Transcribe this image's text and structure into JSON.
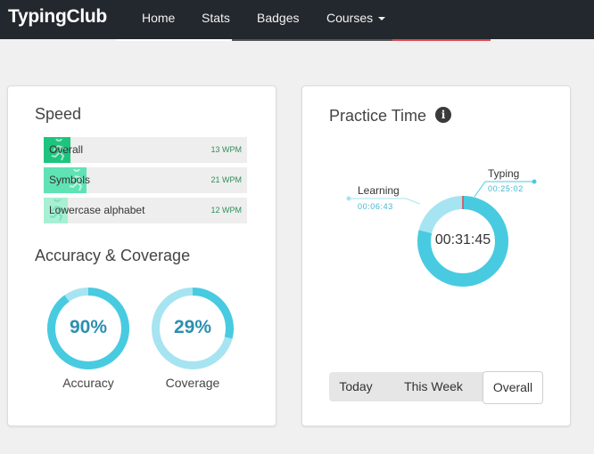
{
  "nav": {
    "brand": "TypingClub",
    "items": [
      "Home",
      "Stats",
      "Badges",
      "Courses"
    ]
  },
  "speed": {
    "title": "Speed",
    "rows": [
      {
        "label": "Overall",
        "value": "13 WPM",
        "fill": 0.13,
        "color": "#1dc47e"
      },
      {
        "label": "Symbols",
        "value": "21 WPM",
        "fill": 0.21,
        "color": "#5fe3b5"
      },
      {
        "label": "Lowercase alphabet",
        "value": "12 WPM",
        "fill": 0.12,
        "color": "#a8efd4"
      }
    ]
  },
  "accuracy": {
    "title": "Accuracy & Coverage",
    "accuracy": {
      "value": "90%",
      "label": "Accuracy",
      "fraction": 0.9
    },
    "coverage": {
      "value": "29%",
      "label": "Coverage",
      "fraction": 0.29
    }
  },
  "practice": {
    "title": "Practice Time",
    "total": "00:31:45",
    "typing": {
      "label": "Typing",
      "time": "00:25:02",
      "minutes": 25.03
    },
    "learning": {
      "label": "Learning",
      "time": "00:06:43",
      "minutes": 6.72
    },
    "tabs": [
      "Today",
      "This Week",
      "Overall"
    ],
    "active_tab": "Overall"
  },
  "colors": {
    "navbar": "#23282e",
    "ring_dark": "#48cbe0",
    "ring_light": "#a6e4f1",
    "number": "#2b8fb0"
  }
}
